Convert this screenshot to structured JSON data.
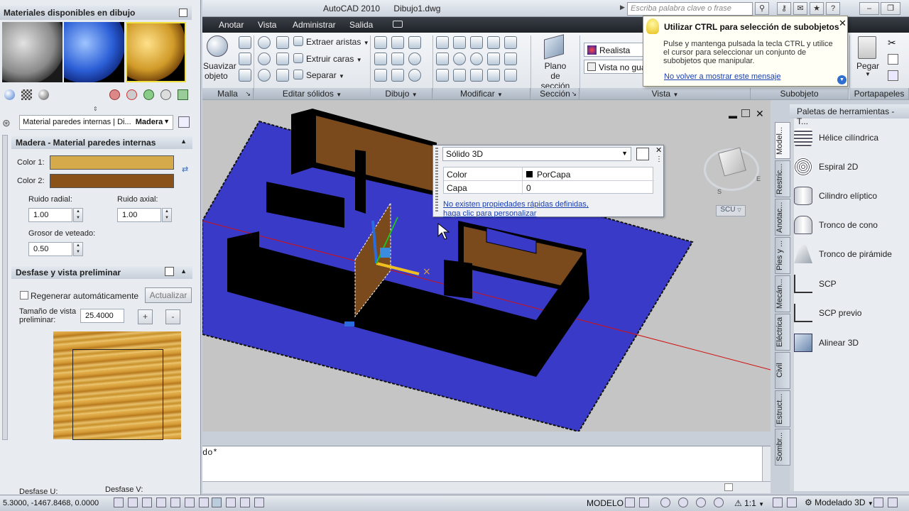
{
  "titlebar": {
    "title_app": "AutoCAD 2010",
    "title_doc": "Dibujo1.dwg",
    "search_placeholder": "Escriba palabra clave o frase"
  },
  "menu": [
    "Anotar",
    "Vista",
    "Administrar",
    "Salida"
  ],
  "ribbon": {
    "suavizar_l1": "Suavizar",
    "suavizar_l2": "objeto",
    "malla": "Malla",
    "extraer_aristas": "Extraer aristas",
    "extruir_caras": "Extruir caras",
    "separar": "Separar",
    "editar_solidos": "Editar sólidos",
    "dibujo": "Dibujo",
    "modificar": "Modificar",
    "plano_l1": "Plano",
    "plano_l2": "de sección",
    "seccion": "Sección",
    "realista": "Realista",
    "vista_no_guardada": "Vista no guardada",
    "vista": "Vista",
    "subobjeto": "Subobjeto",
    "pegar": "Pegar",
    "portapapeles": "Portapapeles"
  },
  "tooltip": {
    "title": "Utilizar CTRL para selección de subobjetos",
    "body_l1": "Pulse y mantenga pulsada la tecla CTRL y utilice",
    "body_l2": "el cursor para seleccionar un conjunto de",
    "body_l3": "subobjetos que manipular.",
    "link": "No volver a mostrar este mensaje"
  },
  "materials_panel": {
    "title": "Materiales disponibles en dibujo",
    "material_select": "Material paredes internas | Di...",
    "material_type": "Madera",
    "section_title": "Madera - Material paredes internas",
    "color1_label": "Color 1:",
    "color2_label": "Color 2:",
    "color1": "#d4aa4a",
    "color2": "#8a5218",
    "ruido_radial_label": "Ruido radial:",
    "ruido_radial_value": "1.00",
    "ruido_axial_label": "Ruido axial:",
    "ruido_axial_value": "1.00",
    "grosor_label": "Grosor de veteado:",
    "grosor_value": "0.50",
    "preview_section_title": "Desfase y vista preliminar",
    "regenerar_label": "Regenerar automáticamente",
    "actualizar_label": "Actualizar",
    "tamano_label_l1": "Tamaño de vista",
    "tamano_label_l2": "preliminar:",
    "tamano_value": "25.4000",
    "plus": "+",
    "minus": "-",
    "desfase_u": "Desfase U:",
    "desfase_v": "Desfase V:"
  },
  "quick_properties": {
    "type": "Sólido 3D",
    "rows": [
      {
        "label": "Color",
        "value": "PorCapa"
      },
      {
        "label": "Capa",
        "value": "0"
      }
    ],
    "link_l1": "No existen propiedades rápidas definidas,",
    "link_l2": "haga clic para personalizar"
  },
  "viewcube": {
    "label": "SCU",
    "letter_e": "E",
    "letter_s": "S"
  },
  "tool_palette": {
    "title": "Paletas de herramientas - T...",
    "items": [
      {
        "label": "Hélice cilíndrica"
      },
      {
        "label": "Espiral 2D"
      },
      {
        "label": "Cilindro elíptico"
      },
      {
        "label": "Tronco de cono"
      },
      {
        "label": "Tronco de pirámide"
      },
      {
        "label": "SCP"
      },
      {
        "label": "SCP previo"
      },
      {
        "label": "Alinear 3D"
      }
    ],
    "tabs": [
      "Model...",
      "Restric...",
      "Anotac...",
      "Pies y ...",
      "Mecán...",
      "Eléctrica",
      "Civil",
      "Estruct...",
      "Sombr..."
    ]
  },
  "command_line": {
    "text": "do*"
  },
  "statusbar": {
    "coords": "5.3000, -1467.8468, 0.0000",
    "modelo": "MODELO",
    "scale": "1:1",
    "workspace": "Modelado 3D"
  },
  "colors": {
    "floor": "#3a3ac8",
    "walls": "#000000",
    "wood": "#7a4a1c"
  }
}
